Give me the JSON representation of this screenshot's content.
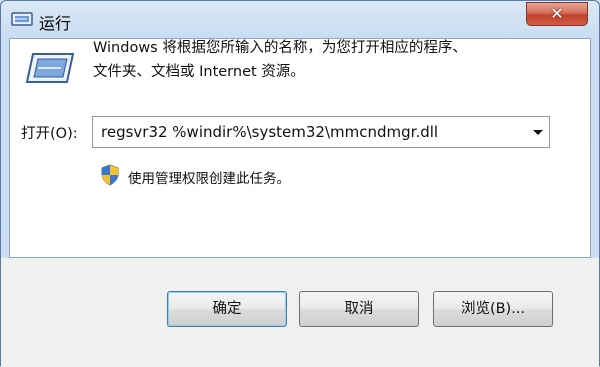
{
  "window": {
    "title": "运行"
  },
  "description": {
    "line1": "Windows 将根据您所输入的名称，为您打开相应的程序、",
    "line2": "文件夹、文档或 Internet 资源。"
  },
  "open_field": {
    "label": "打开(O):",
    "value": "regsvr32 %windir%\\system32\\mmcndmgr.dll"
  },
  "admin_note": "使用管理权限创建此任务。",
  "buttons": {
    "ok": "确定",
    "cancel": "取消",
    "browse": "浏览(B)..."
  },
  "icons": {
    "title": "run-icon",
    "close": "close-icon",
    "main": "run-icon",
    "dropdown": "chevron-down-icon",
    "admin": "shield-icon"
  },
  "colors": {
    "close_button": "#c2422c",
    "frame": "#cfe0f2",
    "default_button_border": "#3c7fb1"
  }
}
